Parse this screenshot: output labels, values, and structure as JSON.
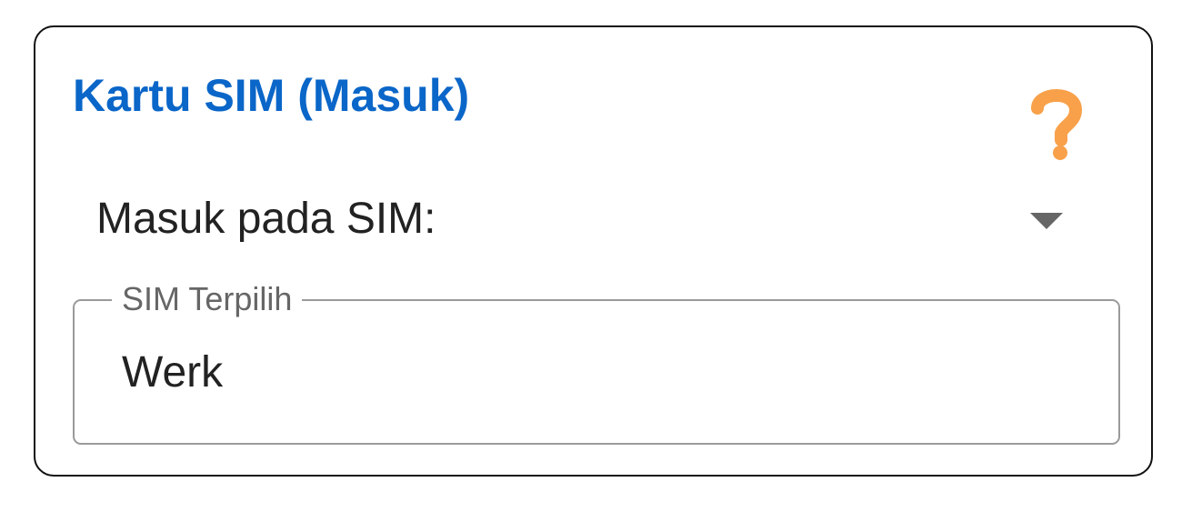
{
  "card": {
    "title": "Kartu SIM (Masuk)",
    "help_icon": "question-mark-icon",
    "help_color": "#f8a14a"
  },
  "dropdown": {
    "label": "Masuk pada SIM:",
    "caret_icon": "caret-down-icon"
  },
  "selected_sim": {
    "label": "SIM Terpilih",
    "value": "Werk"
  },
  "colors": {
    "title": "#0a66c8",
    "border": "#111111",
    "field_border": "#9a9a9a",
    "caret": "#666666"
  }
}
